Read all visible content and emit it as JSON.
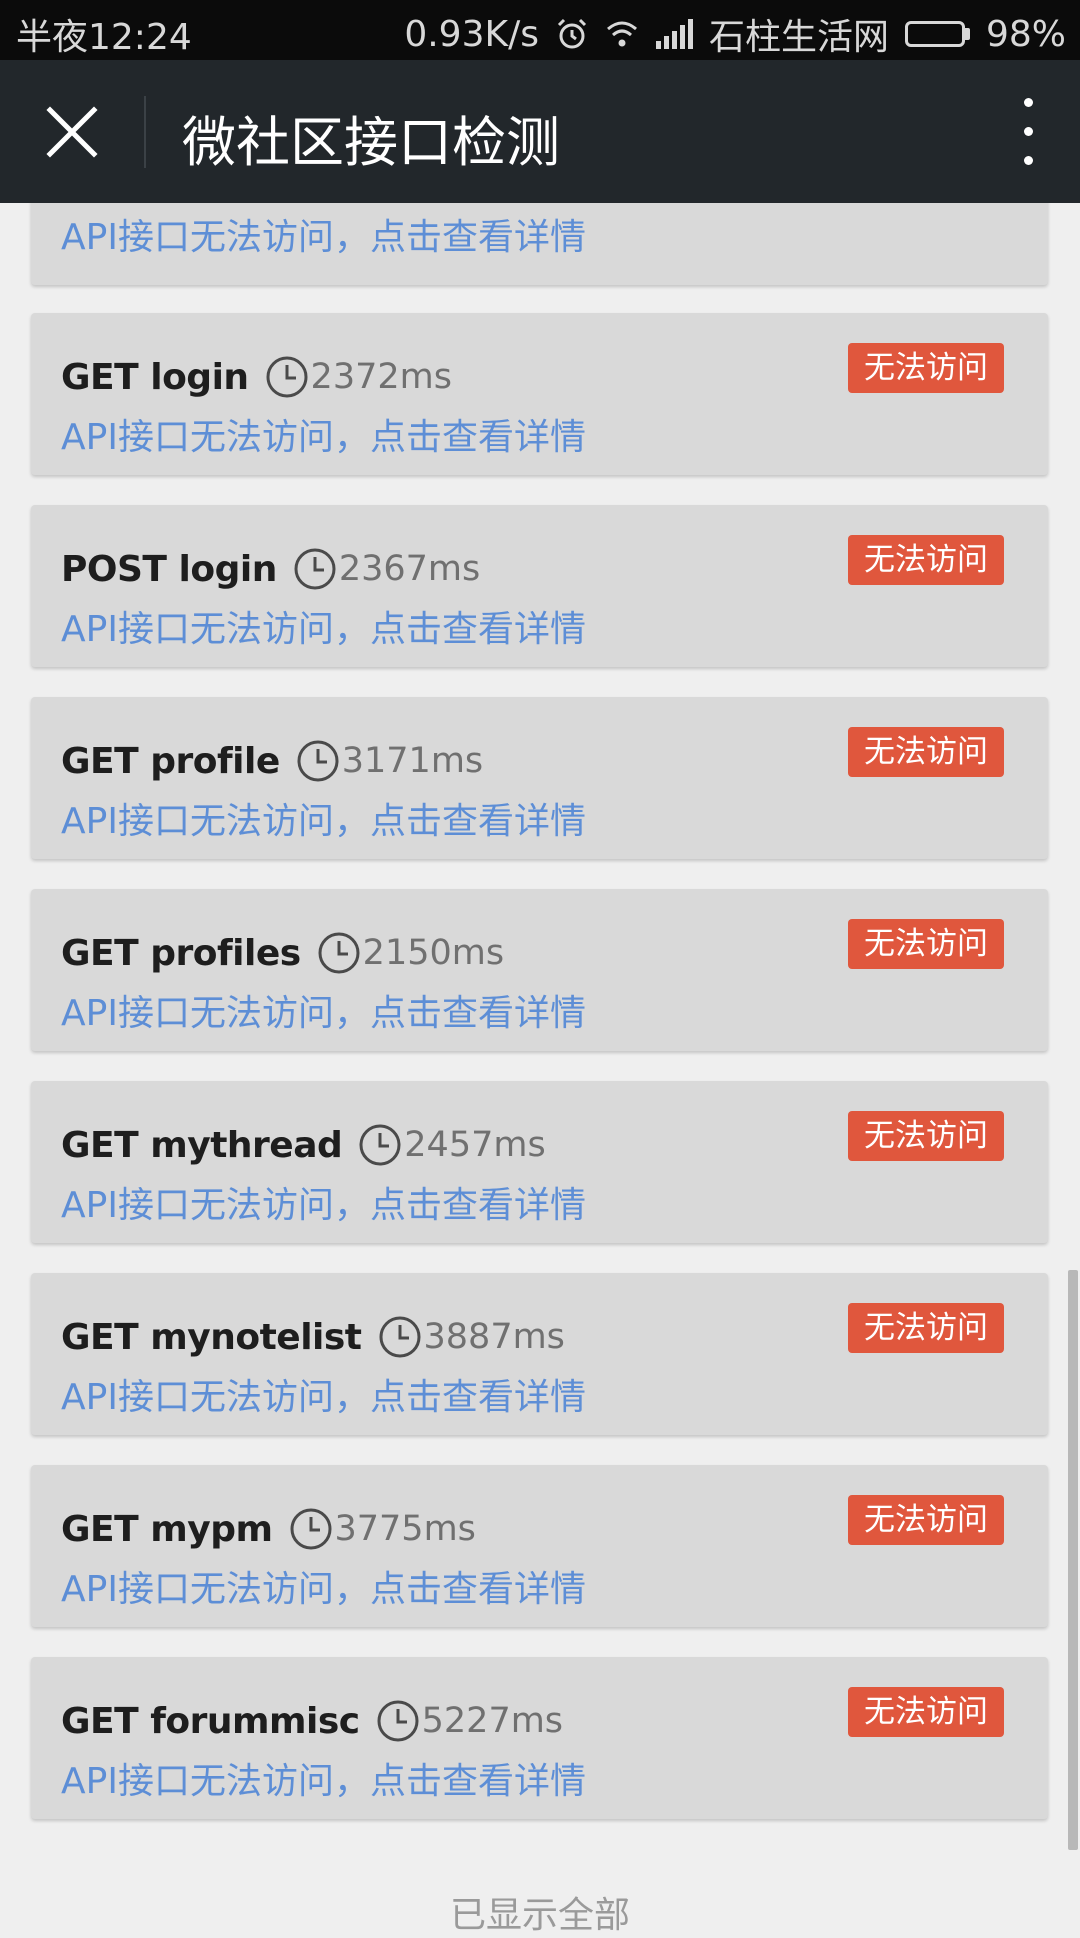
{
  "status_bar": {
    "time": "半夜12:24",
    "speed": "0.93K/s",
    "carrier": "石柱生活网",
    "battery_percent_text": "98%",
    "battery_level": 0.98,
    "icons": [
      "alarm-icon",
      "wifi-icon",
      "signal-icon",
      "battery-icon"
    ]
  },
  "app_bar": {
    "title": "微社区接口检测",
    "close_icon": "close-icon",
    "more_icon": "more-vertical-icon"
  },
  "colors": {
    "app_bar_bg": "#22272b",
    "card_bg": "#d9d9d9",
    "badge_bg": "#e0573d",
    "link_blue": "#5d8ed6"
  },
  "top_partial_item": {
    "detail": "API接口无法访问，点击查看详情"
  },
  "items": [
    {
      "method": "GET login",
      "duration": "2372ms",
      "detail": "API接口无法访问，点击查看详情",
      "status": "无法访问"
    },
    {
      "method": "POST login",
      "duration": "2367ms",
      "detail": "API接口无法访问，点击查看详情",
      "status": "无法访问"
    },
    {
      "method": "GET profile",
      "duration": "3171ms",
      "detail": "API接口无法访问，点击查看详情",
      "status": "无法访问"
    },
    {
      "method": "GET profiles",
      "duration": "2150ms",
      "detail": "API接口无法访问，点击查看详情",
      "status": "无法访问"
    },
    {
      "method": "GET mythread",
      "duration": "2457ms",
      "detail": "API接口无法访问，点击查看详情",
      "status": "无法访问"
    },
    {
      "method": "GET mynotelist",
      "duration": "3887ms",
      "detail": "API接口无法访问，点击查看详情",
      "status": "无法访问"
    },
    {
      "method": "GET mypm",
      "duration": "3775ms",
      "detail": "API接口无法访问，点击查看详情",
      "status": "无法访问"
    },
    {
      "method": "GET forummisc",
      "duration": "5227ms",
      "detail": "API接口无法访问，点击查看详情",
      "status": "无法访问"
    }
  ],
  "footer": {
    "text": "已显示全部"
  }
}
